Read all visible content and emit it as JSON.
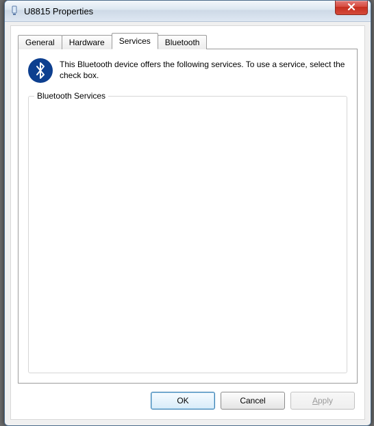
{
  "window": {
    "title": "U8815 Properties"
  },
  "tabs": [
    {
      "label": "General"
    },
    {
      "label": "Hardware"
    },
    {
      "label": "Services"
    },
    {
      "label": "Bluetooth"
    }
  ],
  "active_tab_index": 2,
  "services_page": {
    "info_text": "This Bluetooth device offers the following services. To use a service, select the check box.",
    "fieldset_label": "Bluetooth Services"
  },
  "buttons": {
    "ok": "OK",
    "cancel": "Cancel",
    "apply_prefix": "A",
    "apply_rest": "pply"
  }
}
